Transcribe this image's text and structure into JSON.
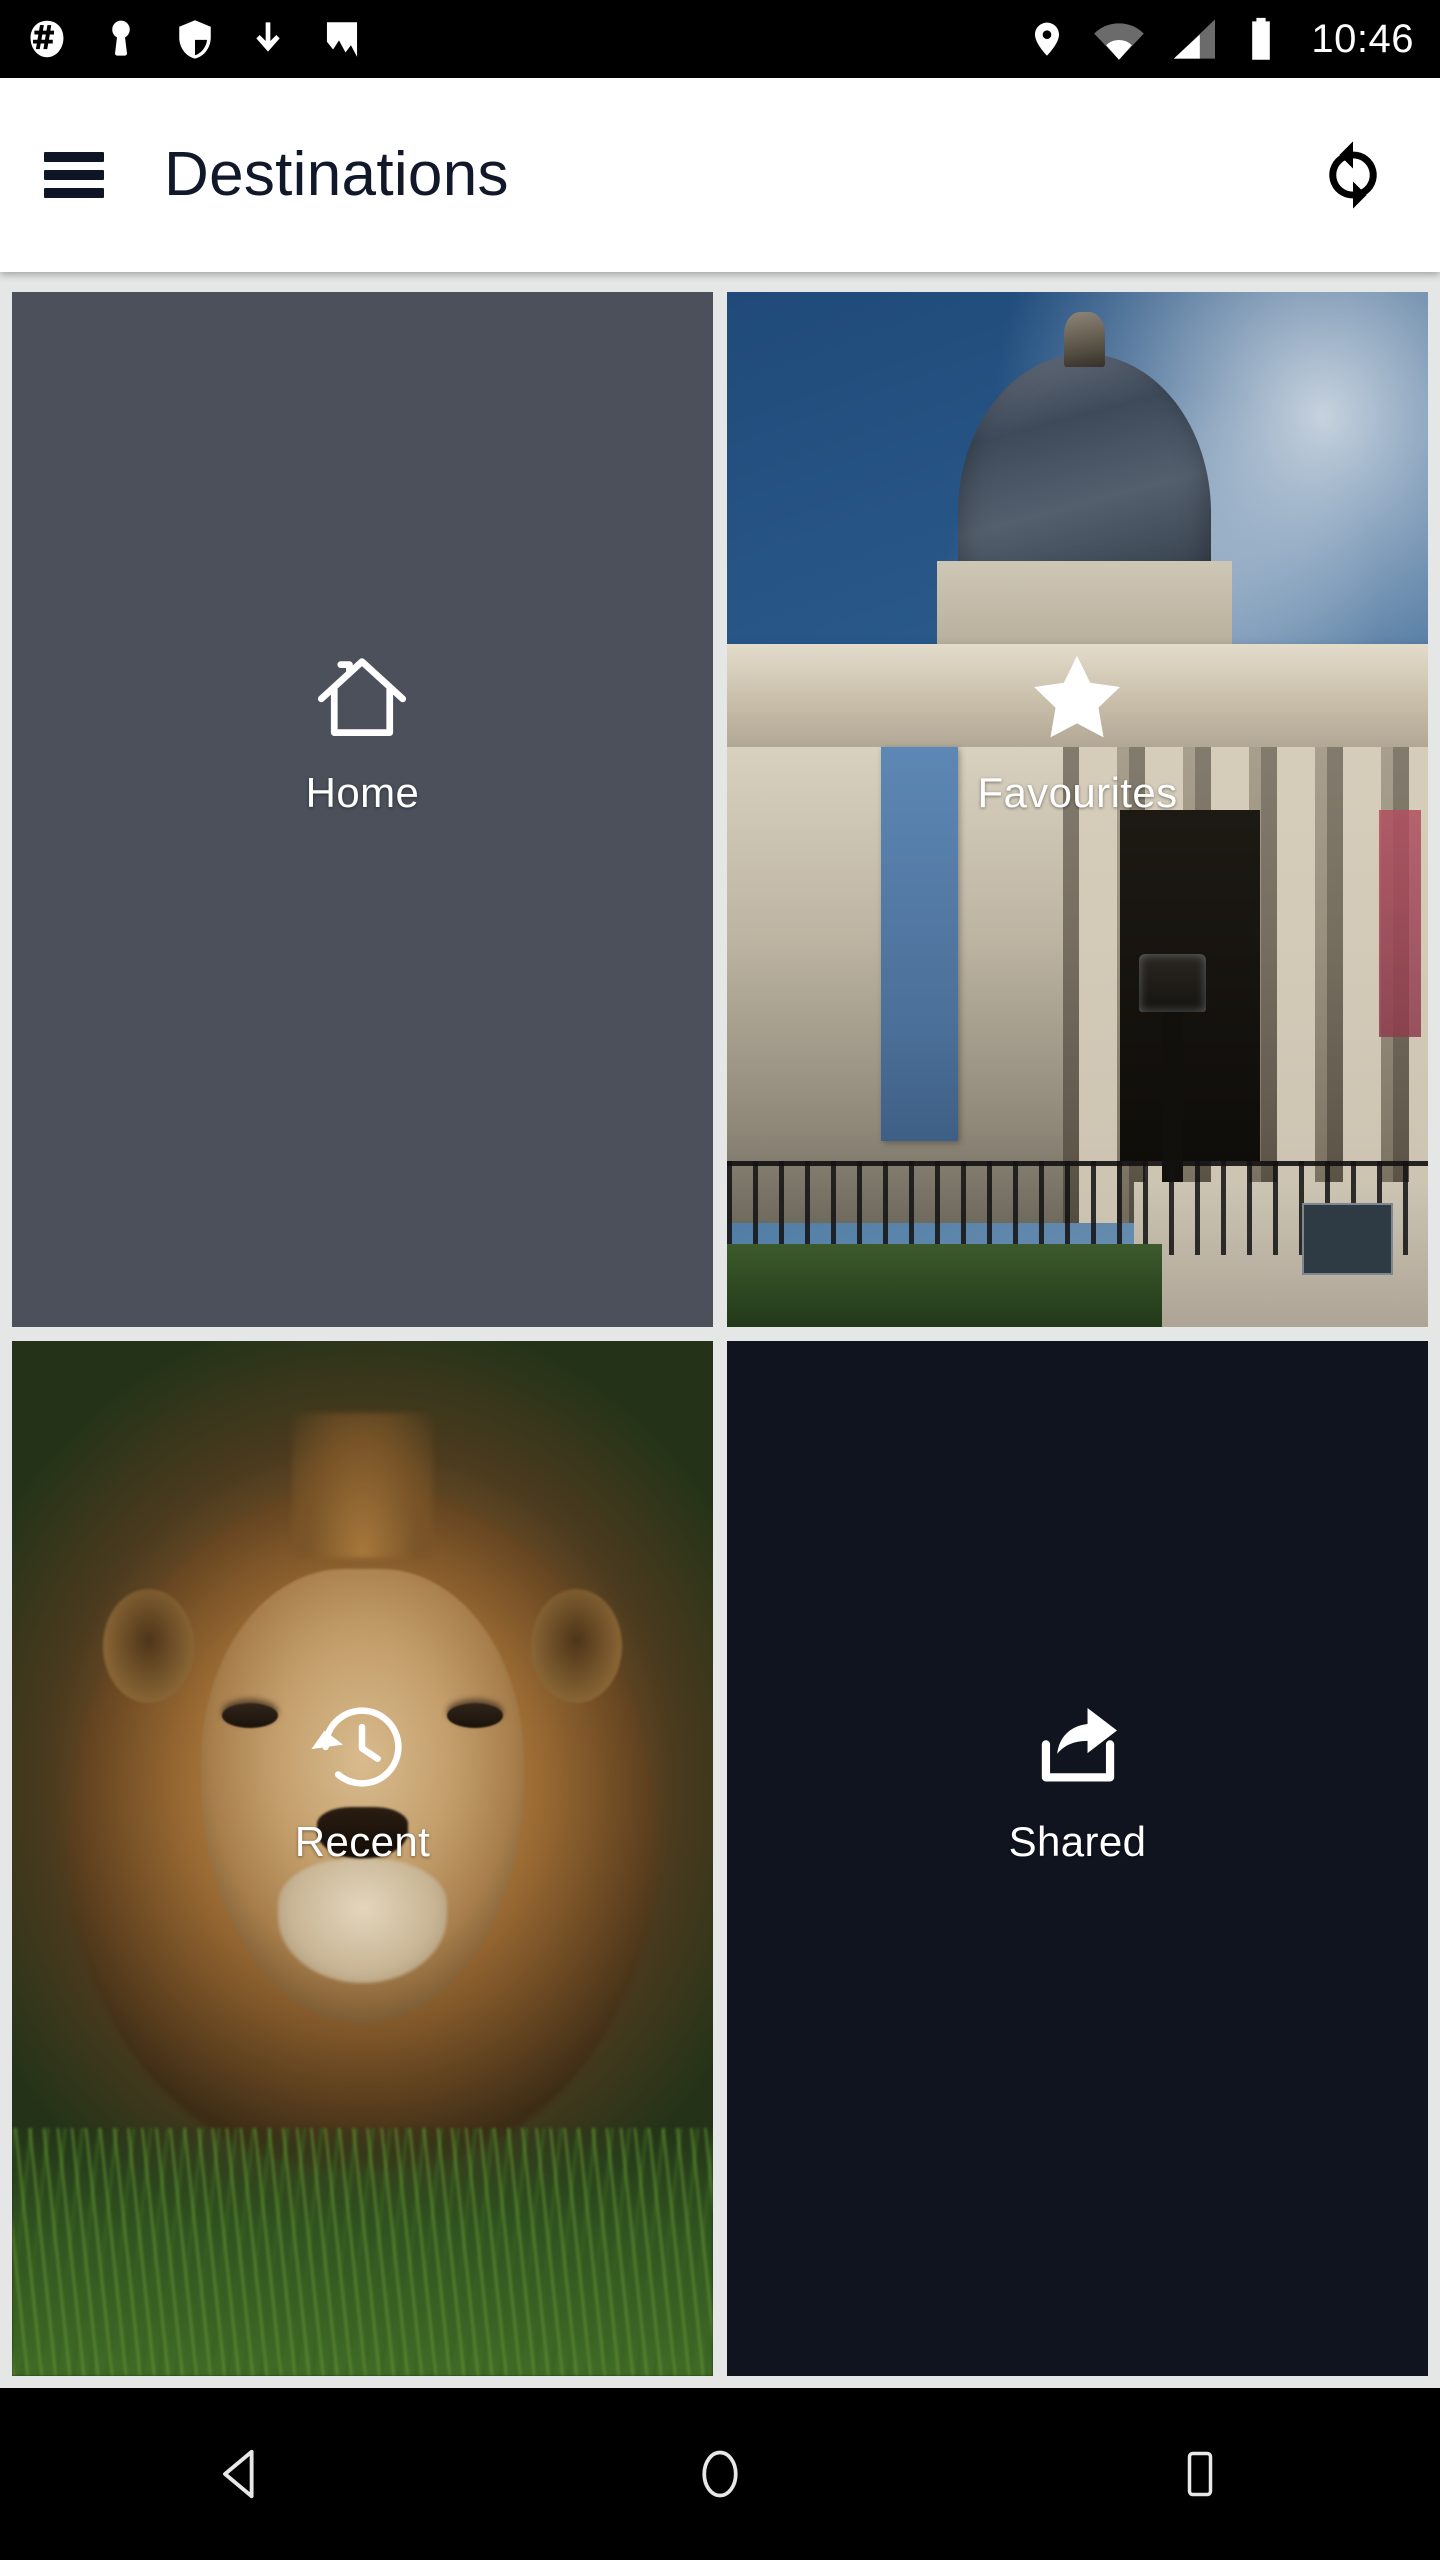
{
  "status_bar": {
    "left_icons": [
      {
        "name": "hash-badge-icon",
        "label": "notification"
      },
      {
        "name": "key-icon",
        "label": "vpn-key"
      },
      {
        "name": "shield-icon",
        "label": "security"
      },
      {
        "name": "download-icon",
        "label": "download"
      },
      {
        "name": "image-icon",
        "label": "screenshot"
      }
    ],
    "right_icons": [
      {
        "name": "location-pin-icon",
        "label": "location"
      },
      {
        "name": "wifi-icon",
        "label": "wifi"
      },
      {
        "name": "cellular-signal-icon",
        "label": "signal"
      },
      {
        "name": "battery-icon",
        "label": "battery-full"
      }
    ],
    "clock": "10:46",
    "background": "#000000",
    "foreground": "#ffffff"
  },
  "app_bar": {
    "menu_icon": "hamburger-menu-icon",
    "title": "Destinations",
    "action_icon": "refresh-sync-icon",
    "background": "#ffffff",
    "title_color": "#10182a"
  },
  "grid": {
    "background": "#e5e6e6",
    "tiles": [
      {
        "id": "home",
        "label": "Home",
        "icon": "home-icon",
        "background_type": "solid",
        "background_color": "#4b505b"
      },
      {
        "id": "favourites",
        "label": "Favourites",
        "icon": "star-icon",
        "background_type": "photo",
        "photo_subject": "neoclassical-museum-building-with-dome",
        "background_color": "#2b5b8c"
      },
      {
        "id": "recent",
        "label": "Recent",
        "icon": "history-clock-icon",
        "background_type": "photo",
        "photo_subject": "lion-in-green-grass",
        "background_color": "#33521f"
      },
      {
        "id": "shared",
        "label": "Shared",
        "icon": "share-out-icon",
        "background_type": "solid",
        "background_color": "#10141f"
      }
    ],
    "label_color": "#ffffff"
  },
  "nav_bar": {
    "background": "#000000",
    "buttons": [
      {
        "name": "back-button",
        "icon": "back-triangle-icon"
      },
      {
        "name": "home-button",
        "icon": "home-circle-icon"
      },
      {
        "name": "recents-button",
        "icon": "recents-square-icon"
      }
    ]
  }
}
